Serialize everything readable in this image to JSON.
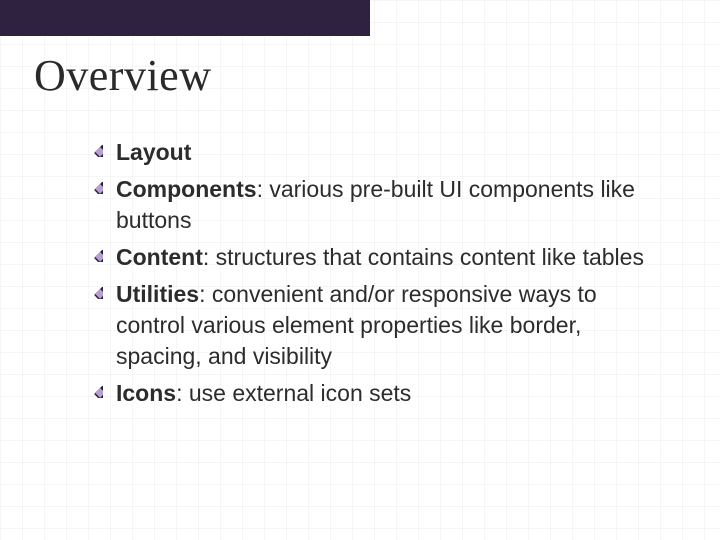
{
  "title": "Overview",
  "bullets": [
    {
      "term": "Layout",
      "desc": ""
    },
    {
      "term": "Components",
      "desc": ": various pre-built UI components like buttons"
    },
    {
      "term": "Content",
      "desc": ": structures that contains content like tables"
    },
    {
      "term": "Utilities",
      "desc": ": convenient and/or responsive ways to control various element properties like border, spacing, and visibility"
    },
    {
      "term": "Icons",
      "desc": ": use external icon sets"
    }
  ],
  "colors": {
    "header_band": "#2f2240",
    "diamond_outer": "#2b1f3a",
    "diamond_inner": "#b79fd1"
  }
}
